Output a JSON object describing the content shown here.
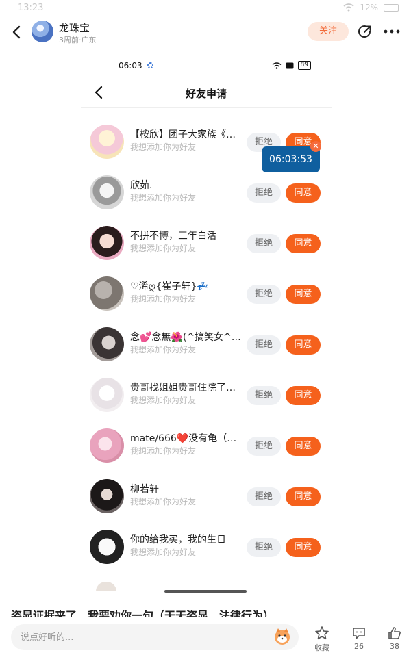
{
  "status_bar": {
    "time": "13:23",
    "battery": "12%"
  },
  "post_header": {
    "author_name": "龙珠宝",
    "author_meta": "3周前·广东",
    "follow_label": "关注"
  },
  "inner_screen": {
    "status_time": "06:03",
    "battery": "89",
    "title": "好友申请",
    "timer": "06:03:53",
    "requests": [
      {
        "name": "【桉欣】团子大家族《…",
        "message": "我想添加你为好友",
        "reject": "拒绝",
        "accept": "同意"
      },
      {
        "name": "欣茹.",
        "message": "我想添加你为好友",
        "reject": "拒绝",
        "accept": "同意"
      },
      {
        "name": "不拼不博，三年白活",
        "message": "我想添加你为好友",
        "reject": "拒绝",
        "accept": "同意"
      },
      {
        "name": "♡浠ღ{崔子轩}💤",
        "message": "我想添加你为好友",
        "reject": "拒绝",
        "accept": "同意"
      },
      {
        "name": "念💕念無🌺(^搞笑女^…",
        "message": "我想添加你为好友",
        "reject": "拒绝",
        "accept": "同意"
      },
      {
        "name": "贵哥找姐姐贵哥住院了…",
        "message": "我想添加你为好友",
        "reject": "拒绝",
        "accept": "同意"
      },
      {
        "name": "mate/666❤️没有龟（…",
        "message": "我想添加你为好友",
        "reject": "拒绝",
        "accept": "同意"
      },
      {
        "name": "柳若轩",
        "message": "我想添加你为好友",
        "reject": "拒绝",
        "accept": "同意"
      },
      {
        "name": "你的给我买，我的生日",
        "message": "我想添加你为好友",
        "reject": "拒绝",
        "accept": "同意"
      }
    ]
  },
  "post_text": "姿显证据来了，我要劝你一句（天天姿显，法律行为）",
  "bottom_bar": {
    "comment_placeholder": "说点好听的...",
    "favorite_label": "收藏",
    "comment_count": "26",
    "like_count": "38"
  },
  "colors": {
    "accent": "#f5611c",
    "follow_bg": "#fde7dc",
    "timer_bg": "#0f5f9f"
  }
}
